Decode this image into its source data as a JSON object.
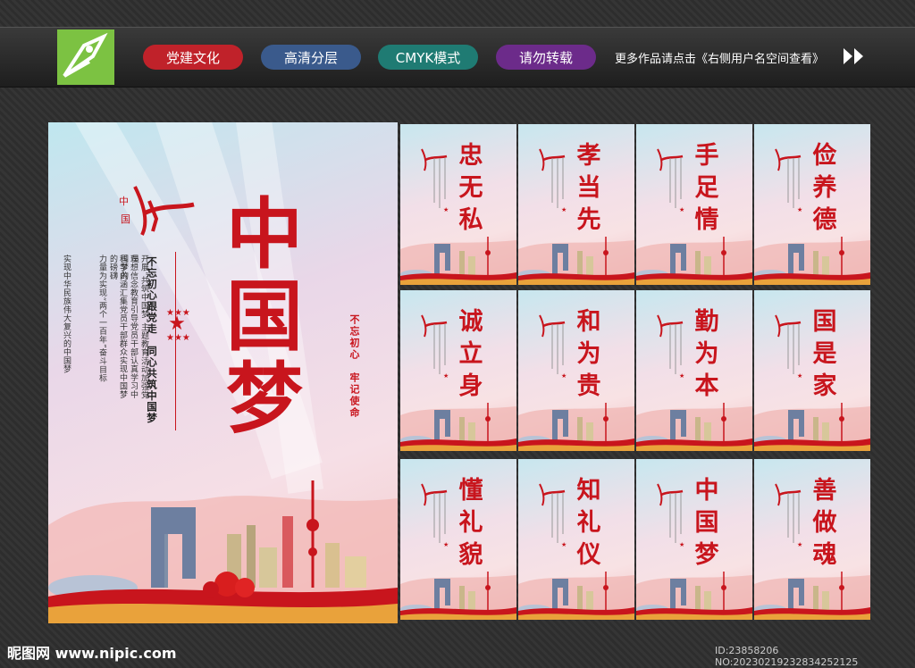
{
  "header": {
    "pills": [
      {
        "label": "党建文化",
        "color": "#c0222a"
      },
      {
        "label": "高清分层",
        "color": "#3a5a8c"
      },
      {
        "label": "CMYK模式",
        "color": "#1f7b73"
      },
      {
        "label": "请勿转载",
        "color": "#6c2b8a"
      }
    ],
    "note": "更多作品请点击《右侧用户名空间查看》"
  },
  "main_poster": {
    "title": "中国梦",
    "slogan_a": "不忘初心跟党走",
    "slogan_b": "同心共筑中国梦",
    "body": [
      "开展“共筑中国梦”主题教育活动加强党员",
      "理想信念教育引导党员干部认真学习中国梦的",
      "科学内涵汇集党员干部群众实现中国梦的磅礴",
      "力量为实现“两个一百年”奋斗目标",
      "实现中华民族伟大复兴的中国梦"
    ],
    "red_a": "不忘初心",
    "red_b": "牢记使命"
  },
  "posters": [
    "忠无私",
    "孝当先",
    "手足情",
    "俭养德",
    "诚立身",
    "和为贵",
    "勤为本",
    "国是家",
    "懂礼貌",
    "知礼仪",
    "中国梦",
    "善做魂"
  ],
  "footer": {
    "site": "昵图网 www.nipic.com",
    "id": "ID:23858206 NO:20230219232834252125"
  },
  "colors": {
    "accent_red": "#c8151d",
    "logo_green": "#7cc242"
  }
}
